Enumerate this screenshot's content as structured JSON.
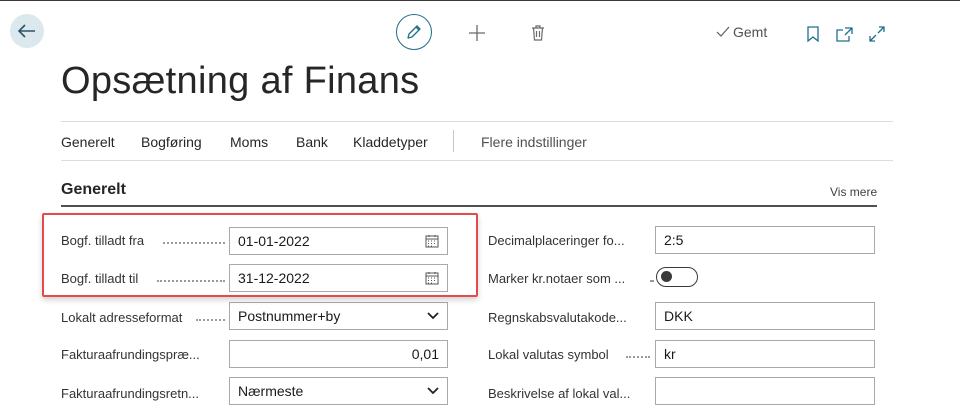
{
  "page": {
    "title": "Opsætning af Finans",
    "saved_label": "Gemt"
  },
  "actions": {
    "back": "back-arrow-icon",
    "edit": "pencil-icon",
    "new": "plus-icon",
    "delete": "trash-icon",
    "bookmark": "bookmark-icon",
    "open_new_window": "open-new-window-icon",
    "expand": "expand-icon"
  },
  "tabs": [
    "Generelt",
    "Bogføring",
    "Moms",
    "Bank",
    "Kladdetyper",
    "Flere indstillinger"
  ],
  "section": {
    "title": "Generelt",
    "show_more": "Vis mere"
  },
  "left_fields": [
    {
      "label": "Bogf. tilladt fra",
      "value": "01-01-2022",
      "type": "date"
    },
    {
      "label": "Bogf. tilladt til",
      "value": "31-12-2022",
      "type": "date"
    },
    {
      "label": "Lokalt adresseformat",
      "value": "Postnummer+by",
      "type": "select"
    },
    {
      "label": "Fakturaafrundingspræ...",
      "value": "0,01",
      "type": "number"
    },
    {
      "label": "Fakturaafrundingsretn...",
      "value": "Nærmeste",
      "type": "select"
    }
  ],
  "right_fields": [
    {
      "label": "Decimalplaceringer fo...",
      "value": "2:5",
      "type": "text"
    },
    {
      "label": "Marker kr.notaer som ...",
      "value": "off",
      "type": "toggle"
    },
    {
      "label": "Regnskabsvalutakode...",
      "value": "DKK",
      "type": "text"
    },
    {
      "label": "Lokal valutas symbol",
      "value": "kr",
      "type": "text"
    },
    {
      "label": "Beskrivelse af lokal val...",
      "value": "",
      "type": "text"
    }
  ],
  "colors": {
    "accent": "#1f6f8b",
    "highlight_border": "#e34a4a",
    "back_button_bg": "#dbe8ee"
  }
}
